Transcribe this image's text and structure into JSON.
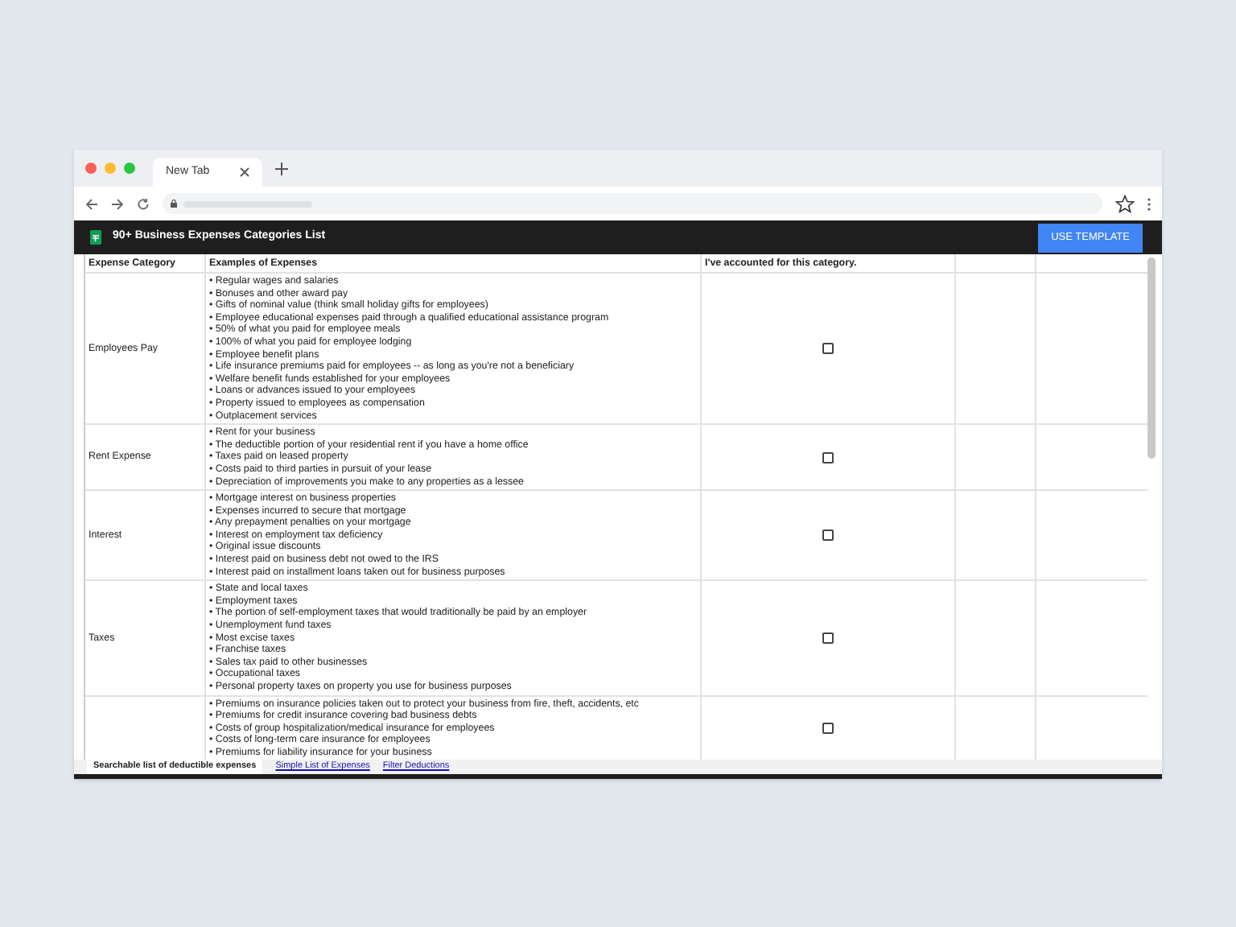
{
  "browser": {
    "tab_title": "New Tab"
  },
  "app": {
    "title": "90+ Business Expenses Categories List",
    "button": "USE TEMPLATE"
  },
  "table": {
    "columns": [
      "Expense Category",
      "Examples of Expenses",
      "I've accounted for this category."
    ],
    "rows": [
      {
        "category": "Employees Pay",
        "checked": false,
        "examples": [
          "• Regular wages and salaries",
          "• Bonuses and other award pay",
          "• Gifts of nominal value (think small holiday gifts for employees)",
          "• Employee educational expenses paid through a qualified educational assistance program",
          "• 50% of what you paid for employee meals",
          "• 100% of what you paid for employee lodging",
          "• Employee benefit plans",
          "• Life insurance premiums paid for employees -- as long as you're not a beneficiary",
          "• Welfare benefit funds established for your employees",
          "• Loans or advances issued to your employees",
          "• Property issued to employees as compensation",
          "• Outplacement services"
        ]
      },
      {
        "category": "Rent Expense",
        "checked": false,
        "examples": [
          "• Rent for your business",
          "• The deductible portion of your residential rent if you have a home office",
          "• Taxes paid on leased property",
          "• Costs paid to third parties in pursuit of your lease",
          "• Depreciation of improvements you make to any properties as a lessee"
        ]
      },
      {
        "category": "Interest",
        "checked": false,
        "examples": [
          "• Mortgage interest on business properties",
          "• Expenses incurred to secure that mortgage",
          "• Any prepayment penalties on your mortgage",
          "• Interest on employment tax deficiency",
          "• Original issue discounts",
          "• Interest paid on business debt not owed to the IRS",
          "• Interest paid on installment loans taken out for business purposes"
        ]
      },
      {
        "category": "Taxes",
        "checked": false,
        "examples": [
          "• State and local taxes",
          "• Employment taxes",
          "• The portion of self-employment taxes that would traditionally be paid by an employer",
          "• Unemployment fund taxes",
          "• Most excise taxes",
          "• Franchise taxes",
          "• Sales tax paid to other businesses",
          "• Occupational taxes",
          "• Personal property taxes on property you use for business purposes"
        ]
      },
      {
        "checked": false,
        "examples": [
          "• Premiums on insurance policies taken out to protect your business from fire, theft, accidents, etc",
          "• Premiums for credit insurance covering bad business debts",
          "• Costs of group hospitalization/medical insurance for employees",
          "• Costs of long-term care insurance for employees",
          "• Premiums for liability insurance for your business"
        ]
      }
    ]
  },
  "sheet_tabs": [
    {
      "label": "Searchable list of deductible expenses",
      "selected": true
    },
    {
      "label": "Simple List of Expenses",
      "selected": false
    },
    {
      "label": "Filter Deductions",
      "selected": false
    }
  ]
}
